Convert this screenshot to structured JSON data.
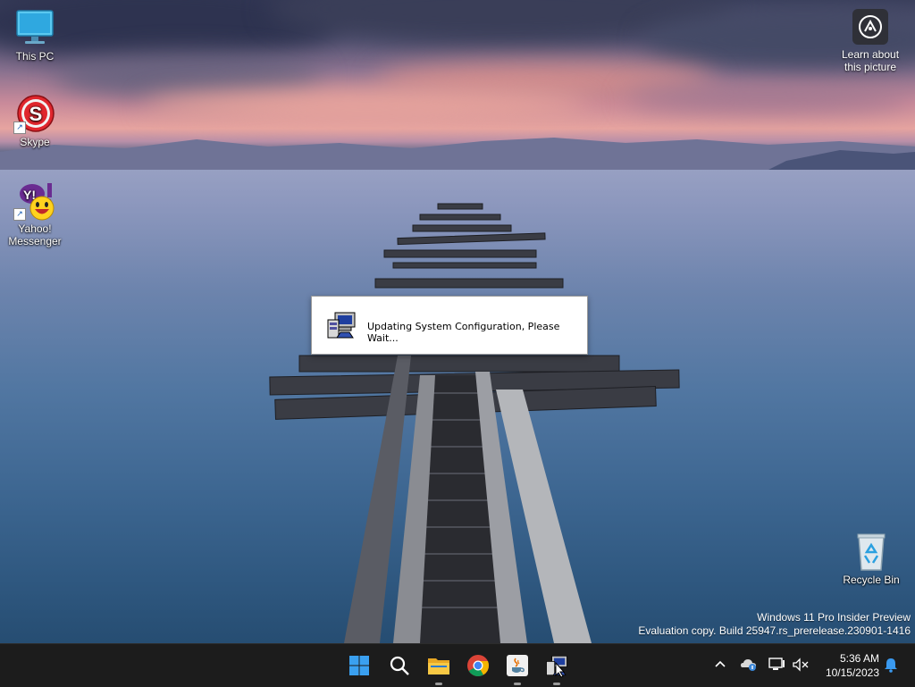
{
  "desktop": {
    "icons": [
      {
        "label": "This PC",
        "icon": "monitor-icon"
      },
      {
        "label": "Skype",
        "icon": "skype-icon"
      },
      {
        "label": "Yahoo!",
        "label2": "Messenger",
        "icon": "yahoo-messenger-icon"
      },
      {
        "label": "Recycle Bin",
        "icon": "recycle-bin-icon"
      }
    ],
    "learn": {
      "line1": "Learn about",
      "line2": "this picture",
      "icon": "camera-badge-icon"
    },
    "watermark": {
      "line1": "Windows 11 Pro Insider Preview",
      "line2": "Evaluation copy. Build 25947.rs_prerelease.230901-1416"
    }
  },
  "dialog": {
    "message": "Updating System Configuration, Please Wait...",
    "icon": "setup-computer-icon"
  },
  "taskbar": {
    "apps": [
      {
        "name": "start-button",
        "icon": "windows-logo-icon"
      },
      {
        "name": "search-button",
        "icon": "search-icon"
      },
      {
        "name": "file-explorer-button",
        "icon": "folder-icon"
      },
      {
        "name": "chrome-button",
        "icon": "chrome-icon"
      },
      {
        "name": "java-button",
        "icon": "java-icon"
      },
      {
        "name": "setup-button",
        "icon": "setup-computer-icon"
      }
    ],
    "tray": [
      "chevron-up-icon",
      "onedrive-icon",
      "network-icon",
      "volume-muted-icon",
      "notification-bell-icon"
    ],
    "clock": {
      "time": "5:36 AM",
      "date": "10/15/2023"
    }
  },
  "colors": {
    "taskbar": "#1c1c1c",
    "accent": "#0078d4",
    "skype_red": "#e0262d",
    "yahoo_purple": "#6a2c91"
  }
}
